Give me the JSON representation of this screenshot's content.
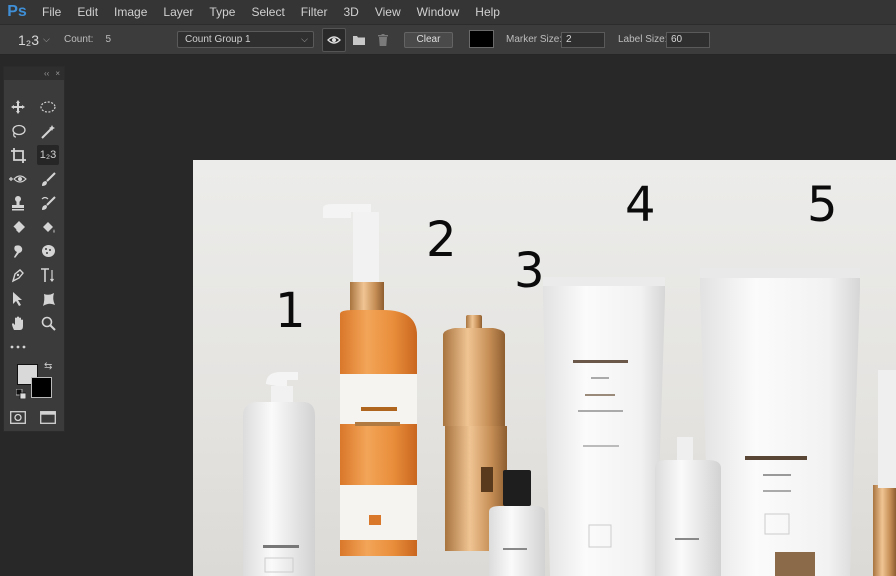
{
  "app": {
    "logo": "Ps"
  },
  "menu": [
    "File",
    "Edit",
    "Image",
    "Layer",
    "Type",
    "Select",
    "Filter",
    "3D",
    "View",
    "Window",
    "Help"
  ],
  "options": {
    "tool_glyph": "1₂3",
    "count_label": "Count:",
    "count_value": "5",
    "group_select": "Count Group 1",
    "clear_label": "Clear",
    "marker_size_label": "Marker Size:",
    "marker_size_value": "2",
    "label_size_label": "Label Size:",
    "label_size_value": "60",
    "color": "#000000"
  },
  "tools_panel": {
    "collapse": "‹‹",
    "close": "×",
    "tools": [
      "move-icon",
      "marquee-icon",
      "lasso-icon",
      "magic-wand-icon",
      "crop-icon",
      "count-icon",
      "red-eye-icon",
      "brush-icon",
      "stamp-icon",
      "history-brush-icon",
      "eraser-icon",
      "paint-bucket-icon",
      "smudge-icon",
      "sponge-icon",
      "pen-icon",
      "vertical-type-icon",
      "path-select-icon",
      "custom-shape-icon",
      "hand-icon",
      "zoom-icon",
      "more-tools-icon"
    ],
    "foreground": "#d9d9d9",
    "background": "#000000"
  },
  "canvas": {
    "count_labels": [
      "1",
      "2",
      "3",
      "4",
      "5"
    ]
  }
}
